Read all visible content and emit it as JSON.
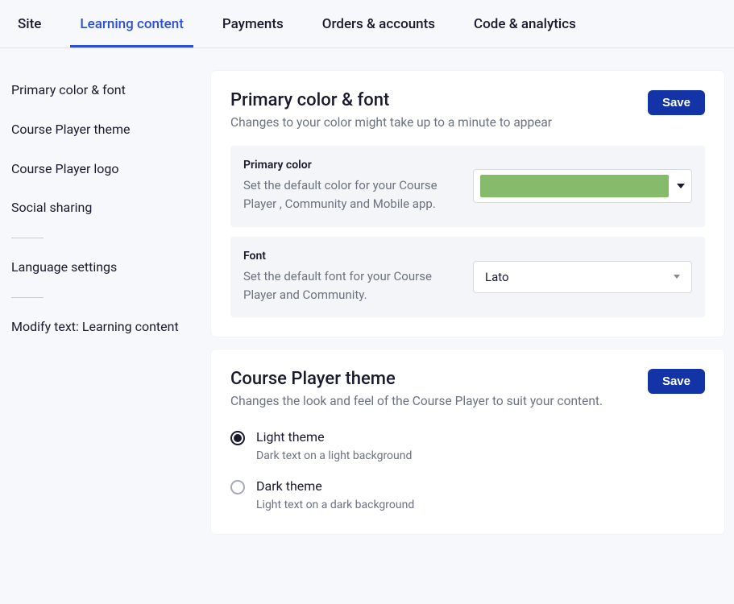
{
  "topnav": {
    "tabs": [
      {
        "label": "Site"
      },
      {
        "label": "Learning content"
      },
      {
        "label": "Payments"
      },
      {
        "label": "Orders & accounts"
      },
      {
        "label": "Code & analytics"
      }
    ],
    "active_index": 1
  },
  "sidebar": {
    "links": [
      {
        "label": "Primary color & font"
      },
      {
        "label": "Course Player theme"
      },
      {
        "label": "Course Player logo"
      },
      {
        "label": "Social sharing"
      }
    ],
    "links2": [
      {
        "label": "Language settings"
      }
    ],
    "links3": [
      {
        "label": "Modify text: Learning content"
      }
    ]
  },
  "card_primary": {
    "title": "Primary color & font",
    "subtitle": "Changes to your color might take up to a minute to appear",
    "save_label": "Save",
    "color_panel": {
      "label": "Primary color",
      "desc": "Set the default color for your Course Player , Community and Mobile app.",
      "swatch_color": "#86bb6b"
    },
    "font_panel": {
      "label": "Font",
      "desc": "Set the default font for your Course Player and Community.",
      "selected": "Lato"
    }
  },
  "card_theme": {
    "title": "Course Player theme",
    "subtitle": "Changes the look and feel of the Course Player to suit your content.",
    "save_label": "Save",
    "options": [
      {
        "label": "Light theme",
        "sub": "Dark text on a light background",
        "selected": true
      },
      {
        "label": "Dark theme",
        "sub": "Light text on a dark background",
        "selected": false
      }
    ]
  }
}
